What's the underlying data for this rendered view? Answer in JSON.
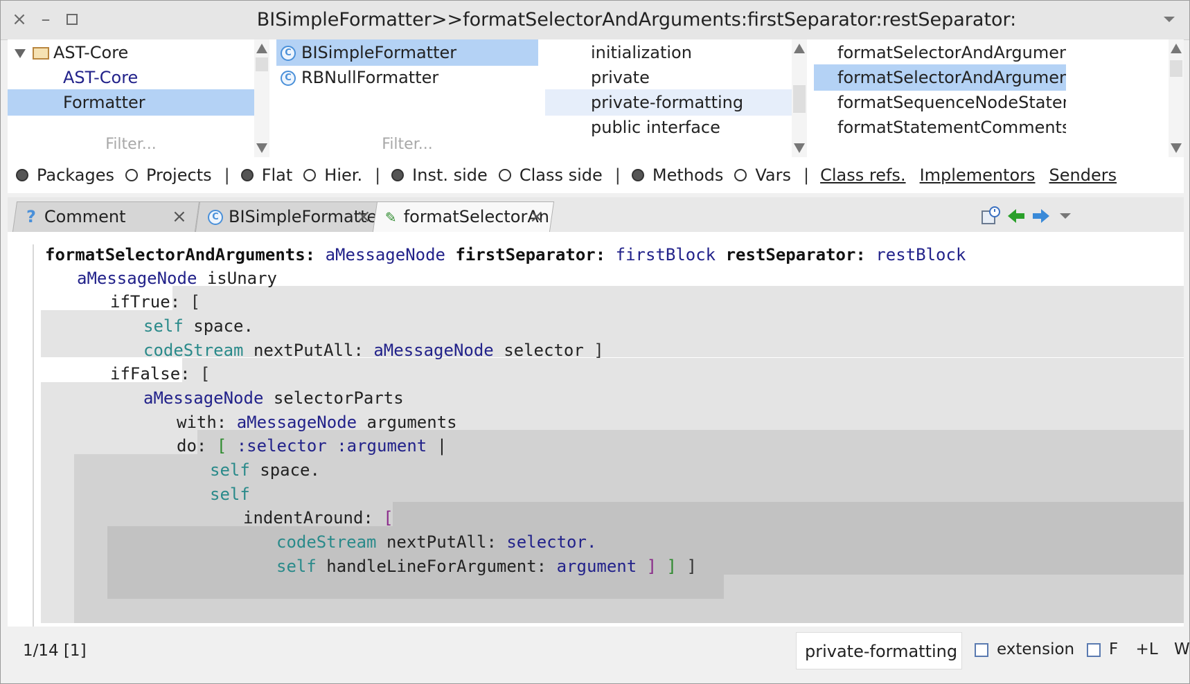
{
  "window": {
    "title": "BISimpleFormatter>>formatSelectorAndArguments:firstSeparator:restSeparator:"
  },
  "packages": {
    "items": [
      {
        "label": "AST-Core",
        "level": 0
      },
      {
        "label": "AST-Core",
        "level": 1
      },
      {
        "label": "Formatter",
        "level": 1,
        "selected": true
      }
    ],
    "filter_placeholder": "Filter..."
  },
  "classes": {
    "items": [
      {
        "label": "BISimpleFormatter",
        "selected": true
      },
      {
        "label": "RBNullFormatter"
      }
    ],
    "filter_placeholder": "Filter..."
  },
  "protocols": {
    "items": [
      {
        "label": "initialization"
      },
      {
        "label": "private"
      },
      {
        "label": "private-formatting",
        "selected": true
      },
      {
        "label": "public interface"
      }
    ]
  },
  "methods": {
    "items": [
      {
        "label": "formatSelectorAndArguments:"
      },
      {
        "label": "formatSelectorAndArguments:firs",
        "selected": true
      },
      {
        "label": "formatSequenceNodeStatements"
      },
      {
        "label": "formatStatementCommentsFor:"
      }
    ]
  },
  "radiobar": {
    "packages": "Packages",
    "projects": "Projects",
    "flat": "Flat",
    "hier": "Hier.",
    "inst_side": "Inst. side",
    "class_side": "Class side",
    "methods": "Methods",
    "vars": "Vars",
    "class_refs": "Class refs.",
    "implementors": "Implementors",
    "senders": "Senders",
    "separator": "|"
  },
  "tabs": [
    {
      "label": "Comment"
    },
    {
      "label": "BISimpleFormatte"
    },
    {
      "label": "formatSelectorAn",
      "active": true
    }
  ],
  "code": {
    "l1_kw1": "formatSelectorAndArguments:",
    "l1_arg1": "aMessageNode",
    "l1_kw2": "firstSeparator:",
    "l1_arg2": "firstBlock",
    "l1_kw3": "restSeparator:",
    "l1_arg3": "restBlock",
    "l2_recv": "aMessageNode",
    "l2_msg": "isUnary",
    "l3_kw": "ifTrue:",
    "l4_self": "self",
    "l4_msg": "space.",
    "l5_ivar": "codeStream",
    "l5_kw": "nextPutAll:",
    "l5_arg": "aMessageNode",
    "l5_msg": "selector",
    "l6_kw": "ifFalse:",
    "l7_arg": "aMessageNode",
    "l7_msg": "selectorParts",
    "l8_kw": "with:",
    "l8_arg": "aMessageNode",
    "l8_msg": "arguments",
    "l9_kw": "do:",
    "l9_params": ":selector :argument",
    "l10_self": "self",
    "l10_msg": "space.",
    "l11_self": "self",
    "l12_kw": "indentAround:",
    "l13_ivar": "codeStream",
    "l13_kw": "nextPutAll:",
    "l13_arg": "selector.",
    "l14_self": "self",
    "l14_kw": "handleLineForArgument:",
    "l14_arg": "argument",
    "open_bracket": "[",
    "close_bracket": "]",
    "pipe": "|"
  },
  "status": {
    "position": "1/14 [1]",
    "protocol": "private-formatting",
    "extension_label": "extension",
    "f_label": "F",
    "l_label": "+L",
    "w_label": "W"
  },
  "colors": {
    "selection": "#b4d2f5",
    "argument": "#22228a",
    "self": "#2a8a8a",
    "bracket_level2": "#2e8b2e",
    "bracket_level3": "#8a2a8a"
  }
}
